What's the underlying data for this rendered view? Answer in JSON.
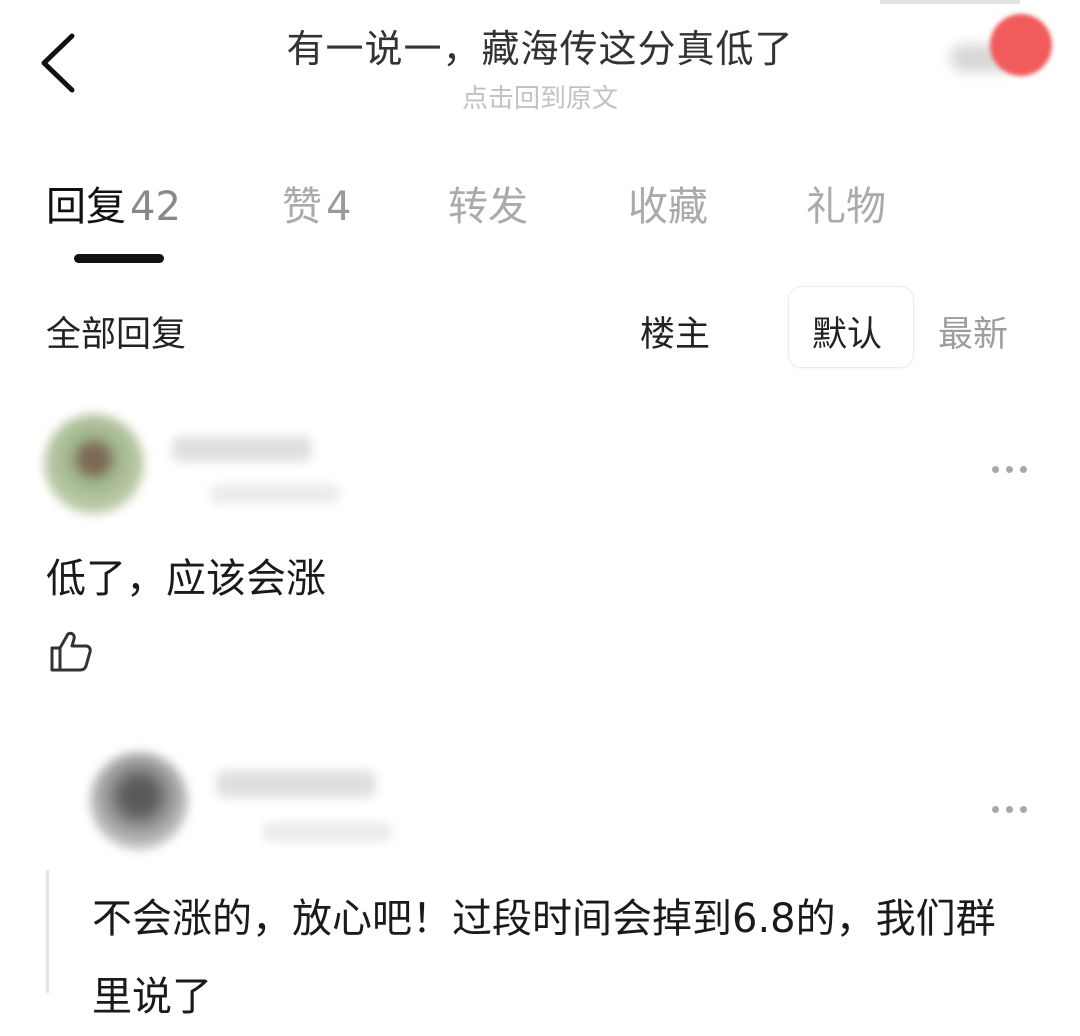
{
  "header": {
    "title": "有一说一，藏海传这分真低了",
    "subtitle": "点击回到原文"
  },
  "tabs": [
    {
      "label": "回复",
      "count": "42"
    },
    {
      "label": "赞",
      "count": "4"
    },
    {
      "label": "转发",
      "count": ""
    },
    {
      "label": "收藏",
      "count": ""
    },
    {
      "label": "礼物",
      "count": ""
    }
  ],
  "filters": {
    "all_label": "全部回复",
    "op_label": "楼主",
    "default_label": "默认",
    "newest_label": "最新"
  },
  "comments": [
    {
      "text": "低了，应该会涨"
    },
    {
      "text": "不会涨的，放心吧！过段时间会掉到6.8的，我们群里说了"
    }
  ],
  "icons": {
    "back": "chevron-left-icon",
    "more": "more-horizontal-icon",
    "like": "thumbs-up-icon"
  },
  "colors": {
    "active_tab": "#111111",
    "inactive_tab": "#aaaaaa",
    "corner_badge": "#f25b5b"
  }
}
